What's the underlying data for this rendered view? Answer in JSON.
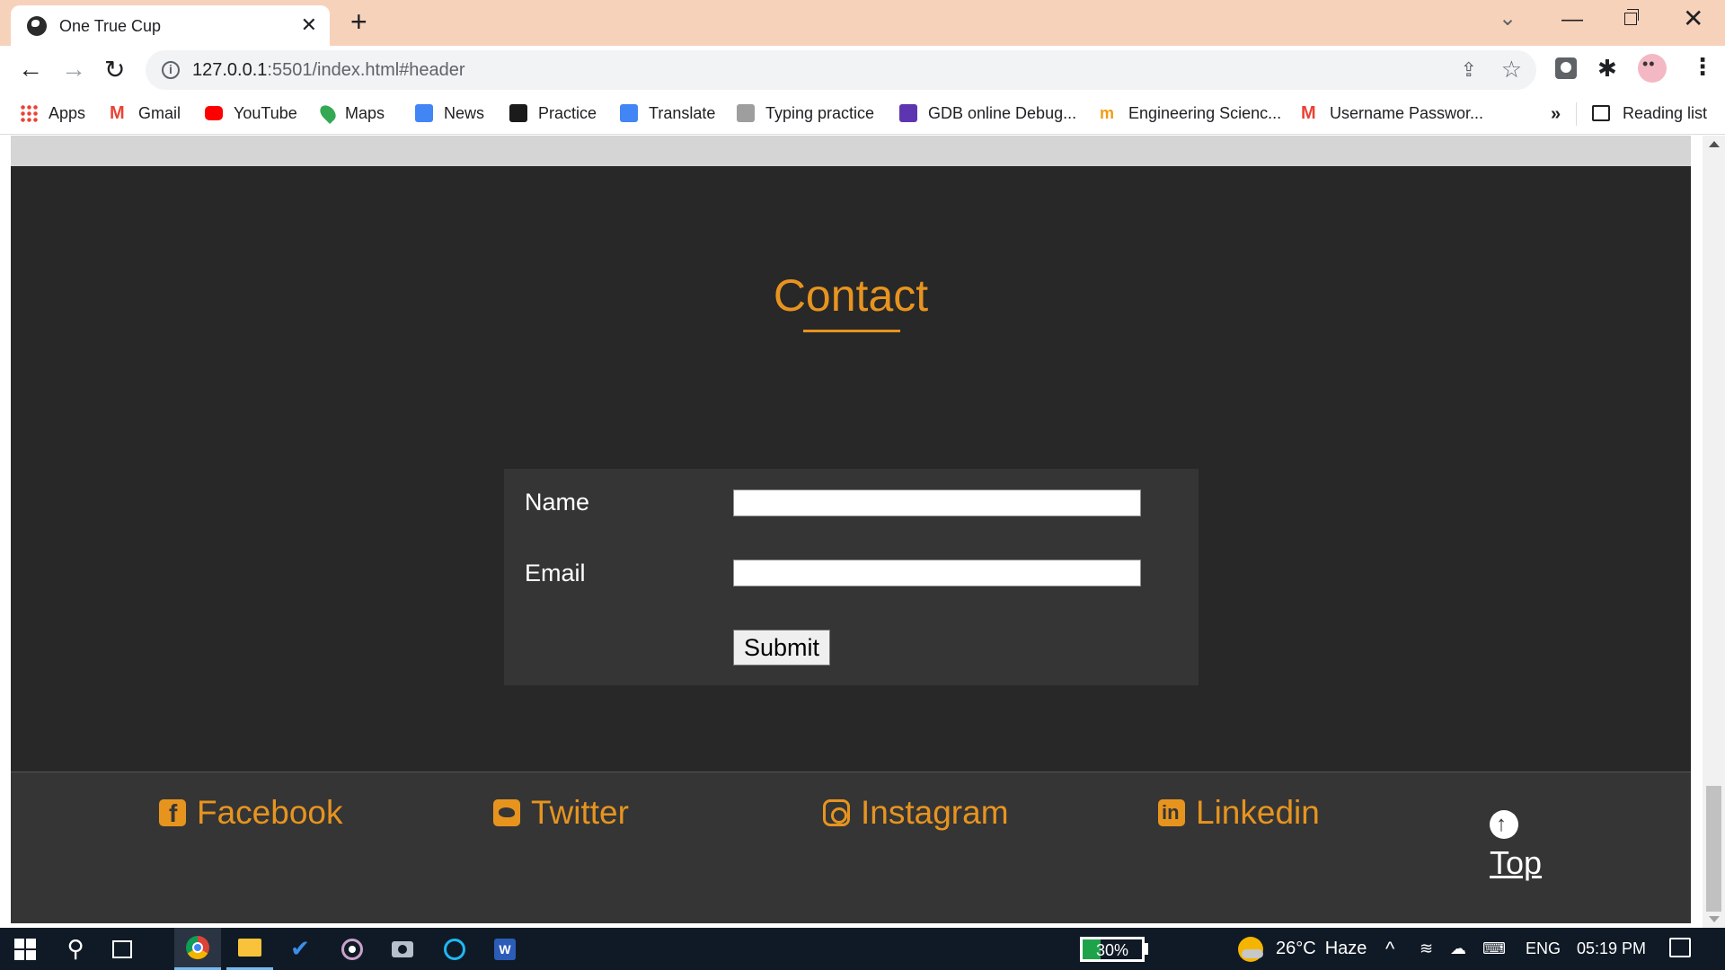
{
  "browser": {
    "tab": {
      "title": "One True Cup",
      "favicon": "globe-icon"
    },
    "url": {
      "host": "127.0.0.1",
      "rest": ":5501/index.html#header"
    },
    "bookmarks": [
      {
        "label": "Apps",
        "icon": "apps-grid-icon",
        "color": "#4285f4"
      },
      {
        "label": "Gmail",
        "icon": "gmail-icon",
        "color": "#ea4335"
      },
      {
        "label": "YouTube",
        "icon": "youtube-icon",
        "color": "#ff0000"
      },
      {
        "label": "Maps",
        "icon": "maps-pin-icon",
        "color": "#34a853"
      },
      {
        "label": "News",
        "icon": "google-news-icon",
        "color": "#4285f4"
      },
      {
        "label": "Practice",
        "icon": "hackerrank-icon",
        "color": "#1b1b1b"
      },
      {
        "label": "Translate",
        "icon": "translate-icon",
        "color": "#4285f4"
      },
      {
        "label": "Typing practice",
        "icon": "typing-icon",
        "color": "#9e9e9e"
      },
      {
        "label": "GDB online Debug...",
        "icon": "gdb-icon",
        "color": "#5e35b1"
      },
      {
        "label": "Engineering Scienc...",
        "icon": "engineering-icon",
        "color": "#f39c12"
      },
      {
        "label": "Username Passwor...",
        "icon": "gmail-icon",
        "color": "#ea4335"
      }
    ],
    "overflow_label": "»",
    "reading_list_label": "Reading list"
  },
  "page": {
    "contact_title": "Contact",
    "form": {
      "name_label": "Name",
      "email_label": "Email",
      "name_value": "",
      "email_value": "",
      "submit_label": "Submit"
    },
    "footer": {
      "links": [
        {
          "label": "Facebook",
          "icon": "facebook-icon"
        },
        {
          "label": "Twitter",
          "icon": "twitter-icon"
        },
        {
          "label": "Instagram",
          "icon": "instagram-icon"
        },
        {
          "label": "Linkedin",
          "icon": "linkedin-icon"
        }
      ],
      "top_label": "Top"
    },
    "accent_color": "#e7941f",
    "background_color": "#282828"
  },
  "taskbar": {
    "battery_percent": 30,
    "battery_label": "30%",
    "weather": {
      "temperature": "26°C",
      "condition": "Haze"
    },
    "language": "ENG",
    "time": "05:19 PM"
  }
}
